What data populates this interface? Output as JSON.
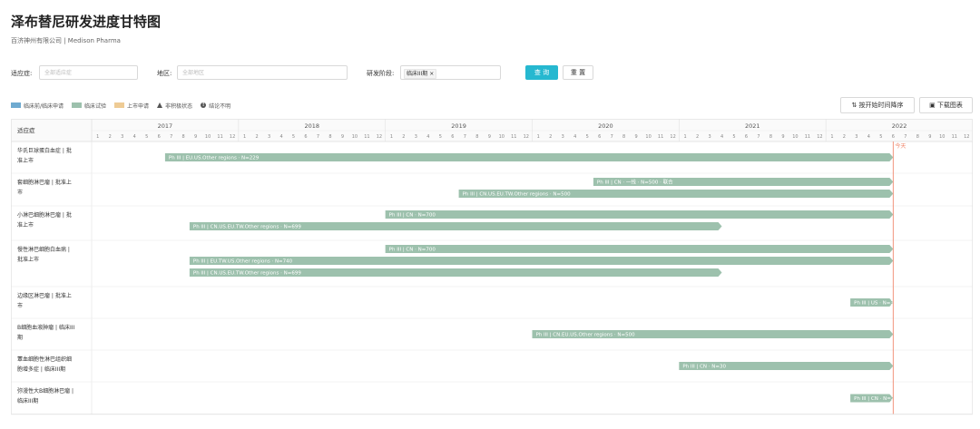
{
  "page": {
    "title": "泽布替尼研发进度甘特图",
    "subtitle": "百济神州有限公司 | Medison Pharma"
  },
  "filters": {
    "indication_label": "适应症:",
    "indication_placeholder": "全部适应症",
    "region_label": "地区:",
    "region_placeholder": "全部地区",
    "stage_label": "研发阶段:",
    "stage_tag": "临床III期 ×",
    "query_label": "查 询",
    "reset_label": "重 置"
  },
  "legend": {
    "items": [
      {
        "label": "临床前/临床申请",
        "color": "#6faad0"
      },
      {
        "label": "临床试验",
        "color": "#9dc1ad"
      },
      {
        "label": "上市申请",
        "color": "#eecb95"
      }
    ],
    "inactive_label": "非积极状态",
    "unclear_label": "结论不明"
  },
  "toolbar": {
    "sort_label": "按开始时间降序",
    "download_label": "下载图表"
  },
  "gantt": {
    "header_label": "适应症",
    "years": [
      "2017",
      "2018",
      "2019",
      "2020",
      "2021",
      "2022"
    ],
    "months": [
      "1",
      "2",
      "3",
      "4",
      "5",
      "6",
      "7",
      "8",
      "9",
      "10",
      "11",
      "12"
    ],
    "today_label": "今天",
    "today": "2022-06",
    "bar_color": "#9dc1ad",
    "bar_text_color": "#5f7a6a",
    "rows": [
      {
        "label_lines": [
          "华氏巨球蛋白血症 | 批",
          "准上市"
        ],
        "bars": [
          {
            "start": "2017-07",
            "text": "Ph III | EU.US.Other regions · N=229",
            "outside": false
          }
        ]
      },
      {
        "label_lines": [
          "套细胞淋巴瘤 | 批准上",
          "市"
        ],
        "bars": [
          {
            "start": "2020-06",
            "text": "Ph III | CN · 一线 · N=500 · 联合",
            "outside": false
          },
          {
            "start": "2019-07",
            "text": "Ph III | CN.US.EU.TW.Other regions · N=500",
            "outside": false
          }
        ]
      },
      {
        "label_lines": [
          "小淋巴细胞淋巴瘤 | 批",
          "准上市"
        ],
        "bars": [
          {
            "start": "2019-01",
            "end": "2022-06",
            "text": "Ph III | CN · N=700",
            "outside": false
          },
          {
            "start": "2017-09",
            "end": "2021-04",
            "text": "Ph III | CN.US.EU.TW.Other regions · N=699",
            "outside": false
          }
        ]
      },
      {
        "label_lines": [
          "慢性淋巴细胞白血病 |",
          "批准上市"
        ],
        "bars": [
          {
            "start": "2019-01",
            "end": "2022-06",
            "text": "Ph III | CN · N=700",
            "outside": false
          },
          {
            "start": "2017-09",
            "end": "2022-06",
            "text": "Ph III | EU.TW.US.Other regions · N=740",
            "outside": false
          },
          {
            "start": "2017-09",
            "end": "2021-04",
            "text": "Ph III | CN.US.EU.TW.Other regions · N=699",
            "outside": false
          }
        ]
      },
      {
        "label_lines": [
          "边缘区淋巴瘤 | 批准上",
          "市"
        ],
        "bars": [
          {
            "start": "2022-03",
            "text": "Ph III | US · N=372",
            "outside": true
          }
        ]
      },
      {
        "label_lines": [
          "B细胞血液肿瘤 | 临床III",
          "期"
        ],
        "bars": [
          {
            "start": "2020-01",
            "text": "Ph III | CN.EU.US.Other regions · N=500",
            "outside": false
          }
        ]
      },
      {
        "label_lines": [
          "蕈血细胞性淋巴组织细",
          "胞增多症 | 临床III期"
        ],
        "bars": [
          {
            "start": "2021-01",
            "text": "Ph III | CN · N=30",
            "outside": false
          }
        ]
      },
      {
        "label_lines": [
          "弥漫性大B细胞淋巴瘤 |",
          "临床III期"
        ],
        "bars": [
          {
            "start": "2022-03",
            "text": "Ph III | CN · N=280",
            "outside": true
          }
        ]
      }
    ]
  }
}
